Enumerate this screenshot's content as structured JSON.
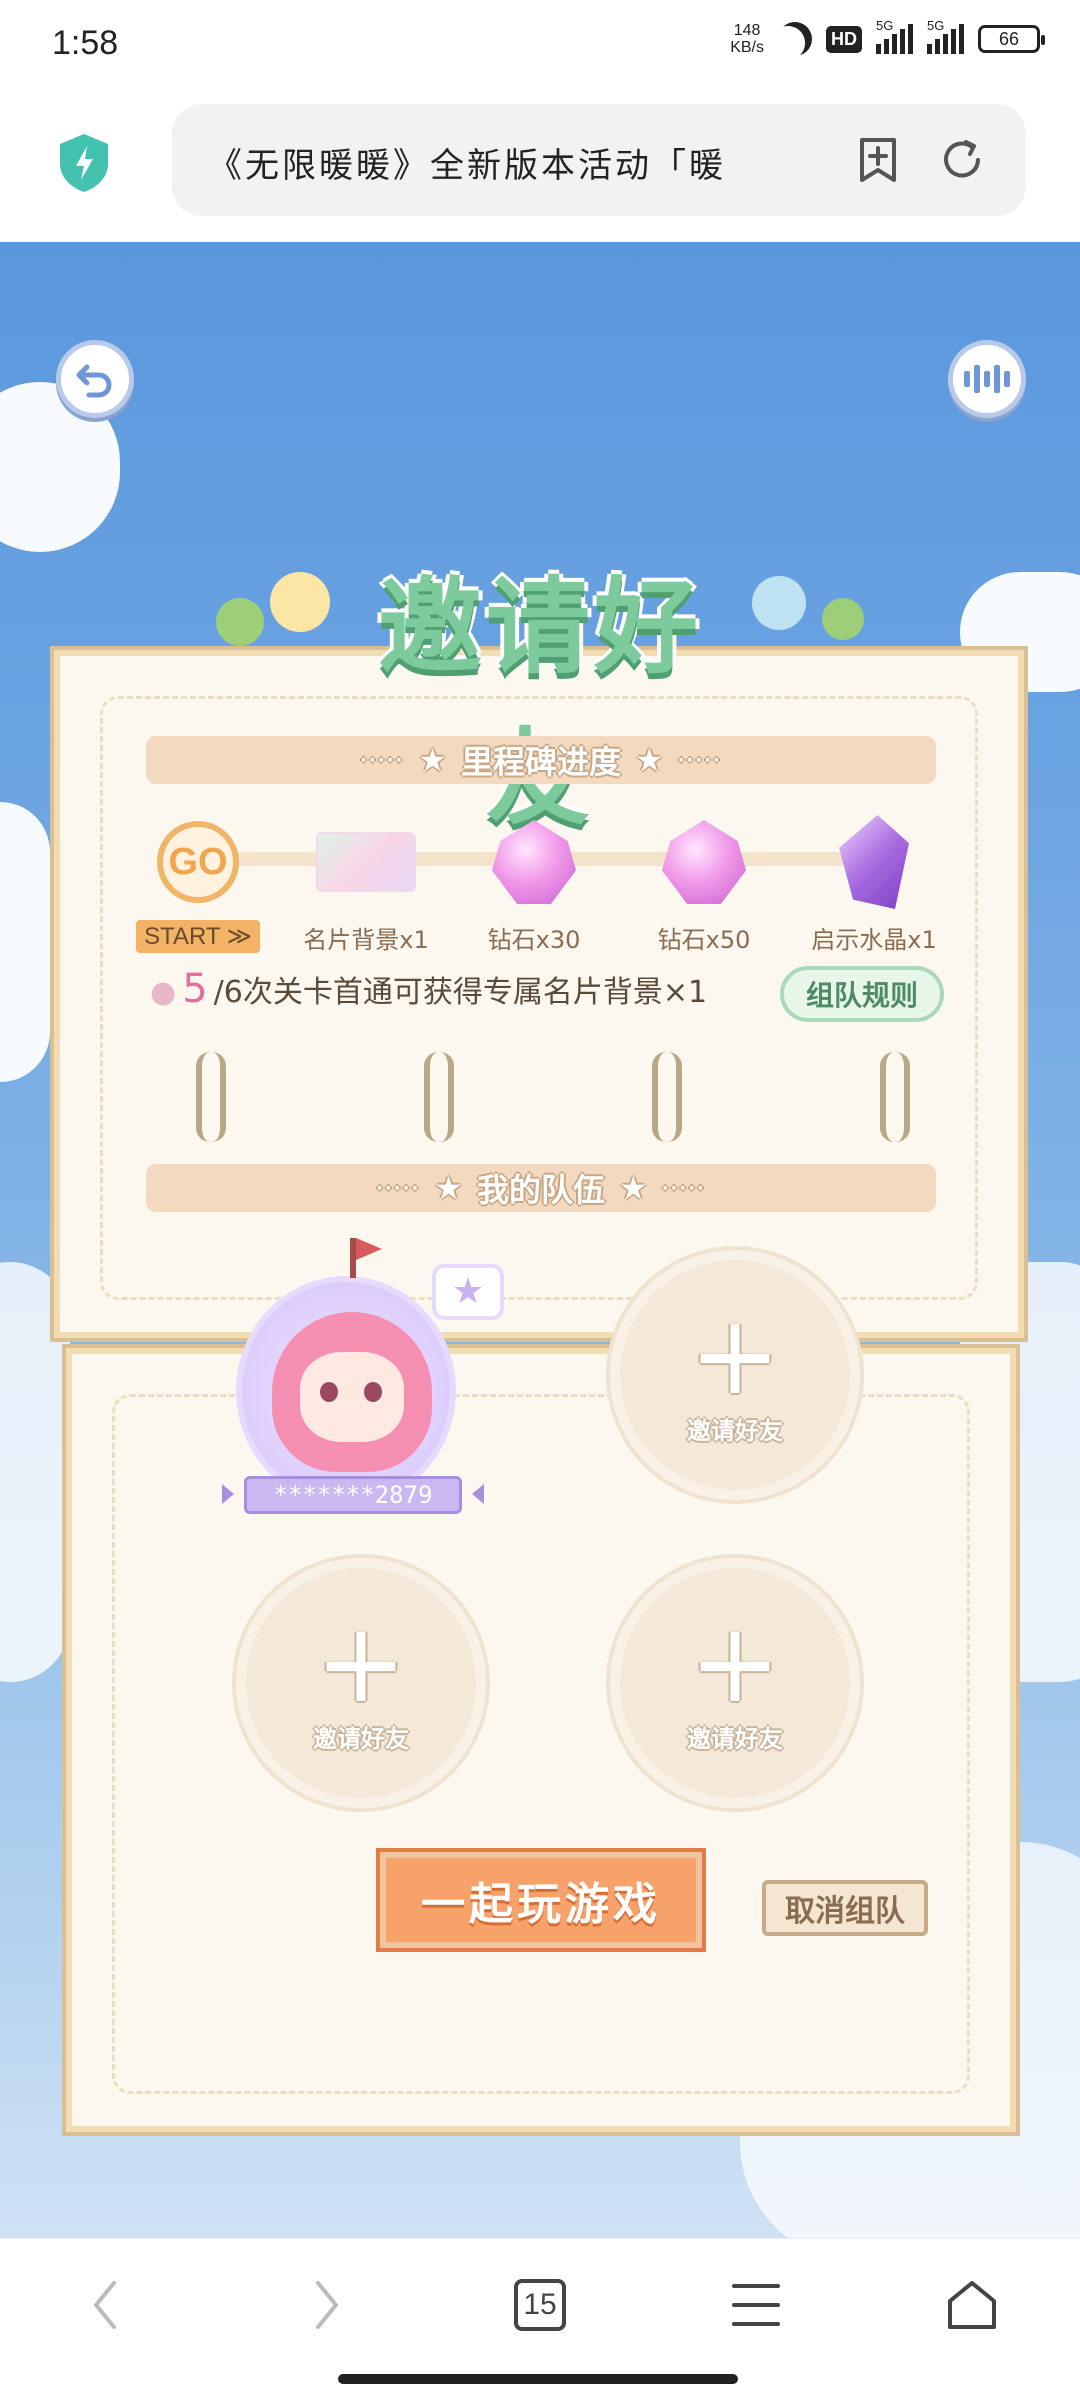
{
  "status_bar": {
    "time": "1:58",
    "net_speed": "148",
    "net_unit": "KB/s",
    "hd_label": "HD",
    "sim1": "5G",
    "sim2": "5G",
    "battery": "66"
  },
  "browser": {
    "url_title": "《无限暖暖》全新版本活动「暖",
    "add_tab_icon": "bookmark-plus-icon",
    "refresh_icon": "refresh-icon"
  },
  "game": {
    "title": "邀请好友",
    "milestone_banner": "里程碑进度",
    "milestones": [
      {
        "icon": "GO",
        "label": "START ≫"
      },
      {
        "icon": "card-bg",
        "label": "名片背景x1"
      },
      {
        "icon": "gem",
        "label": "钻石x30"
      },
      {
        "icon": "gem",
        "label": "钻石x50"
      },
      {
        "icon": "crystal",
        "label": "启示水晶x1"
      }
    ],
    "progress_current": "5",
    "progress_text": "/6次关卡首通可获得专属名片背景×1",
    "rule_button": "组队规则",
    "team_banner": "我的队伍",
    "member_name": "*******2879",
    "invite_label": "邀请好友",
    "play_button": "一起玩游戏",
    "cancel_button": "取消组队",
    "colors": {
      "sky": "#5a97dd",
      "panel": "#fdf8ef",
      "title": "#7dcb9c",
      "play": "#f7a26b"
    }
  },
  "bottom_nav": {
    "tab_count": "15"
  }
}
